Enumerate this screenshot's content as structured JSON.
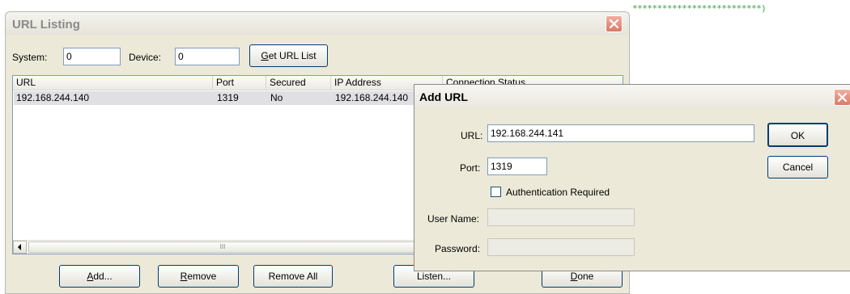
{
  "background_note_text": "**************************)",
  "listing": {
    "title": "URL Listing",
    "system_label": "System:",
    "system_value": "0",
    "device_label": "Device:",
    "device_value": "0",
    "get_url_list_prefix": "G",
    "get_url_list_rest": "et URL List",
    "columns": [
      "URL",
      "Port",
      "Secured",
      "IP Address",
      "Connection Status"
    ],
    "rows": [
      {
        "url": "192.168.244.140",
        "port": "1319",
        "secured": "No",
        "ip": "192.168.244.140",
        "status": ""
      }
    ],
    "scroll_thumb_text": "III",
    "buttons": {
      "add_prefix": "A",
      "add_rest": "dd...",
      "remove_prefix": "R",
      "remove_rest": "emove",
      "remove_all": "Remove All",
      "listen": "Listen...",
      "done_prefix": "D",
      "done_rest": "one"
    }
  },
  "add_url": {
    "title": "Add URL",
    "url_label": "URL:",
    "url_value": "192.168.244.141",
    "port_label": "Port:",
    "port_value": "1319",
    "auth_label": "Authentication Required",
    "auth_checked": false,
    "username_label": "User Name:",
    "username_value": "",
    "password_label": "Password:",
    "password_value": "",
    "ok_label": "OK",
    "cancel_label": "Cancel"
  },
  "colors": {
    "window_face": "#ece9d8",
    "field_border": "#7f9db9",
    "close_red": "#d97a66",
    "selected_row": "#e0dfe3",
    "dotted_line": "#3aa13a"
  }
}
